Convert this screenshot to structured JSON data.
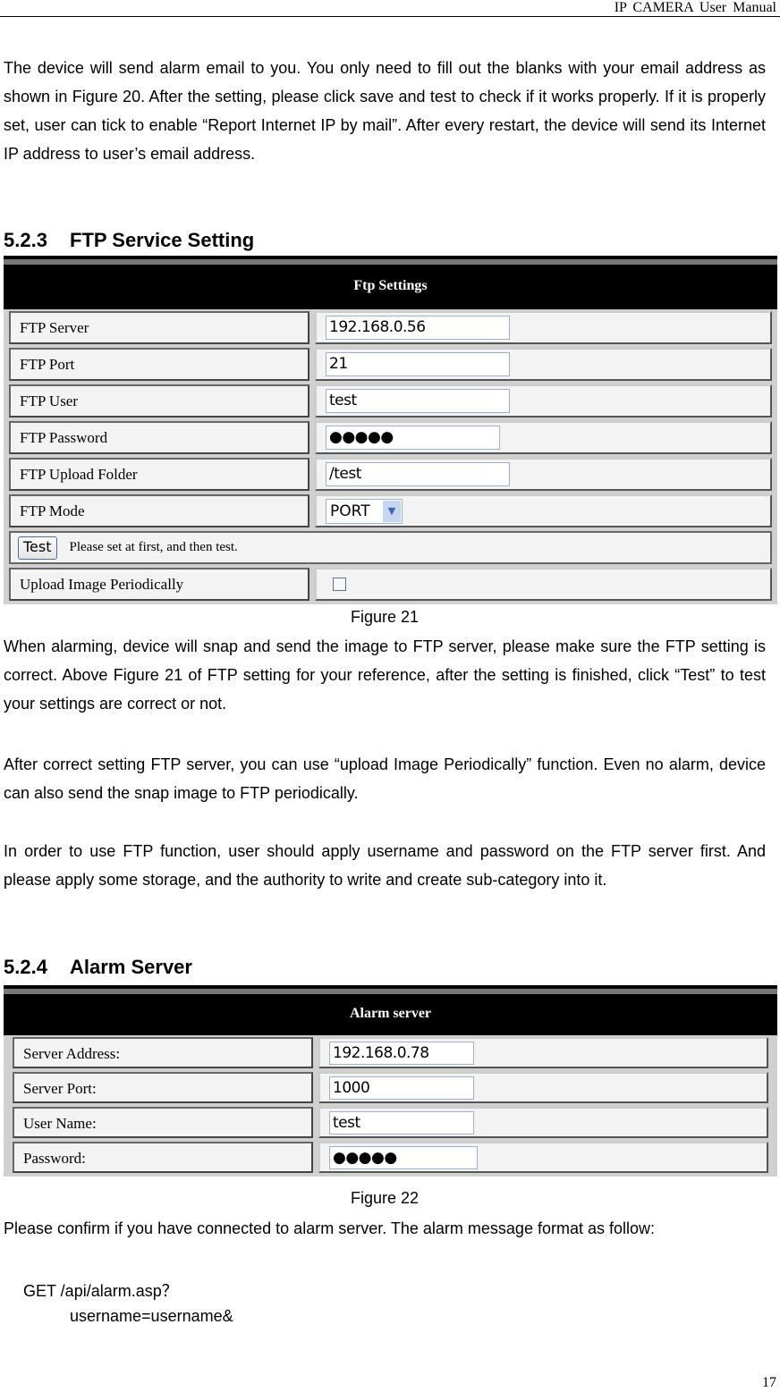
{
  "header": {
    "title": "IP  CAMERA  User  Manual"
  },
  "intro_paragraph": "The device will send alarm email to you. You only need to fill out the blanks with your email address as shown in Figure 20. After the setting, please click save and test to check if it works properly. If it is properly set, user can tick to enable “Report Internet IP by mail”. After every restart, the device will send its Internet IP address to user’s email address.",
  "section_ftp": {
    "number": "5.2.3",
    "title": "FTP Service Setting",
    "panel": {
      "title": "Ftp Settings",
      "fields": [
        {
          "label": "FTP Server",
          "value": "192.168.0.56"
        },
        {
          "label": "FTP Port",
          "value": "21"
        },
        {
          "label": "FTP User",
          "value": "test"
        },
        {
          "label": "FTP Password",
          "value": "●●●●●"
        },
        {
          "label": "FTP Upload Folder",
          "value": "/test"
        },
        {
          "label": "FTP Mode",
          "value": "PORT"
        }
      ],
      "test_button": "Test",
      "test_hint": "Please set at first, and then test.",
      "upload_label": "Upload Image Periodically",
      "upload_checked": false
    },
    "caption": "Figure 21",
    "paragraphs": [
      "When alarming, device will snap and send the image to FTP server, please make sure the FTP setting is correct. Above Figure 21 of FTP setting for your reference, after the setting is finished, click “Test” to test your settings are correct or not.",
      "After correct setting FTP server, you can use “upload Image Periodically” function. Even no alarm, device can also send the snap image to FTP periodically.",
      "In order to use FTP function, user should apply username and password on the FTP server first. And please apply some storage, and the authority to write and create sub-category into it."
    ]
  },
  "section_alarm": {
    "number": "5.2.4",
    "title": "Alarm Server",
    "panel": {
      "title": "Alarm server",
      "fields": [
        {
          "label": "Server Address:",
          "value": "192.168.0.78"
        },
        {
          "label": "Server Port:",
          "value": "1000"
        },
        {
          "label": "User Name:",
          "value": "test"
        },
        {
          "label": "Password:",
          "value": "●●●●●"
        }
      ]
    },
    "caption": "Figure 22",
    "paragraph": "Please confirm if you have connected to alarm server. The alarm message format as follow:",
    "code_lines": [
      "GET /api/alarm.asp？",
      "username=username&"
    ]
  },
  "page_number": "17"
}
